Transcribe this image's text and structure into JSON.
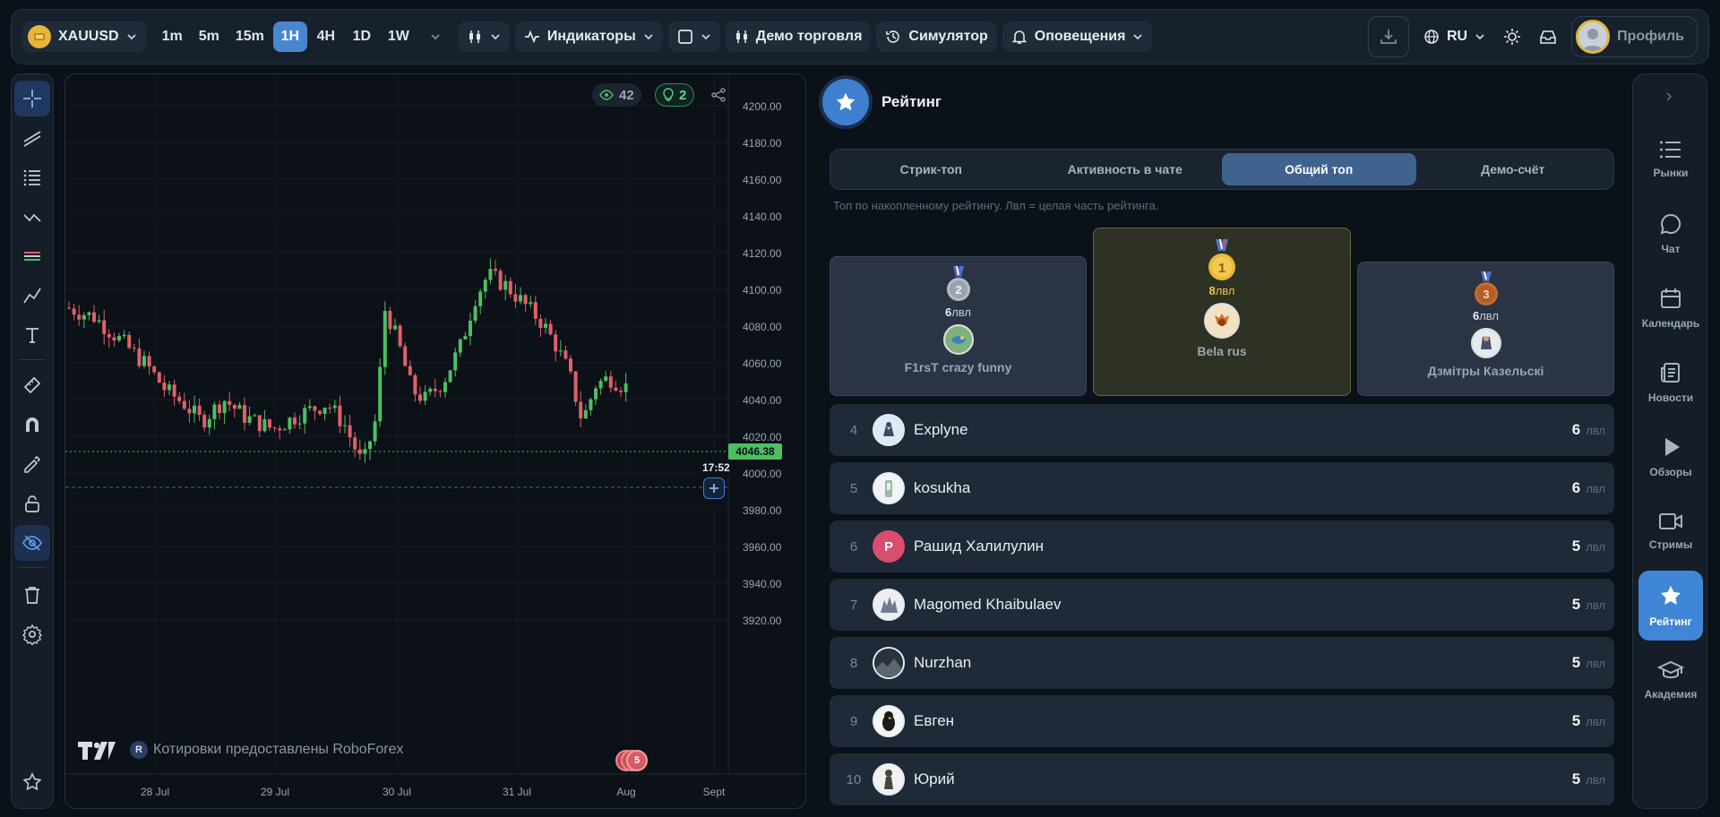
{
  "topbar": {
    "symbol": "XAUUSD",
    "timeframes": [
      "1m",
      "5m",
      "15m",
      "1H",
      "4H",
      "1D",
      "1W"
    ],
    "active_timeframe": "1H",
    "indicators_label": "Индикаторы",
    "demo_label": "Демо торговля",
    "simulator_label": "Симулятор",
    "alerts_label": "Оповещения",
    "language": "RU",
    "profile_label": "Профиль"
  },
  "chart": {
    "views": "42",
    "ideas": "2",
    "current_price": "4046.38",
    "countdown": "17:52",
    "attribution": "Котировки предоставлены RoboForex",
    "attribution_badge": "R",
    "events_count": "5",
    "price_axis": [
      "4200.00",
      "4180.00",
      "4160.00",
      "4140.00",
      "4120.00",
      "4100.00",
      "4080.00",
      "4060.00",
      "4040.00",
      "4020.00",
      "4000.00",
      "3980.00",
      "3960.00",
      "3940.00",
      "3920.00"
    ],
    "time_axis": [
      "28 Jul",
      "29 Jul",
      "30 Jul",
      "31 Jul",
      "Aug",
      "Sept"
    ]
  },
  "panel": {
    "title": "Рейтинг",
    "tabs": [
      "Стрик-топ",
      "Активность в чате",
      "Общий топ",
      "Демо-счёт"
    ],
    "active_tab": "Общий топ",
    "subtitle": "Топ по накопленному рейтингу. Лвл = целая часть рейтинга.",
    "podium": [
      {
        "place": "2",
        "level": "6",
        "unit": "лвл",
        "name": "F1rsT crazy funny"
      },
      {
        "place": "1",
        "level": "8",
        "unit": "лвл",
        "name": "Bela rus"
      },
      {
        "place": "3",
        "level": "6",
        "unit": "лвл",
        "name": "Дзмітры Казельскі"
      }
    ],
    "rows": [
      {
        "rank": "4",
        "name": "Explyne",
        "level": "6",
        "unit": "лвл"
      },
      {
        "rank": "5",
        "name": "kosukha",
        "level": "6",
        "unit": "лвл"
      },
      {
        "rank": "6",
        "name": "Рашид Халилулин",
        "level": "5",
        "unit": "лвл",
        "initial": "Р"
      },
      {
        "rank": "7",
        "name": "Magomed Khaibulaev",
        "level": "5",
        "unit": "лвл"
      },
      {
        "rank": "8",
        "name": "Nurzhan",
        "level": "5",
        "unit": "лвл"
      },
      {
        "rank": "9",
        "name": "Евген",
        "level": "5",
        "unit": "лвл"
      },
      {
        "rank": "10",
        "name": "Юрий",
        "level": "5",
        "unit": "лвл"
      }
    ]
  },
  "rightnav": [
    {
      "label": "Рынки",
      "icon": "list-icon"
    },
    {
      "label": "Чат",
      "icon": "chat-icon"
    },
    {
      "label": "Календарь",
      "icon": "calendar-icon"
    },
    {
      "label": "Новости",
      "icon": "news-icon"
    },
    {
      "label": "Обзоры",
      "icon": "play-icon"
    },
    {
      "label": "Стримы",
      "icon": "video-icon"
    },
    {
      "label": "Рейтинг",
      "icon": "star-icon",
      "active": true
    },
    {
      "label": "Академия",
      "icon": "graduation-cap-icon"
    }
  ],
  "colors": {
    "accent": "#4a86d0",
    "up": "#4cbf63",
    "down": "#e0606a",
    "gold": "#e2b43c",
    "bg": "#0b1118"
  }
}
